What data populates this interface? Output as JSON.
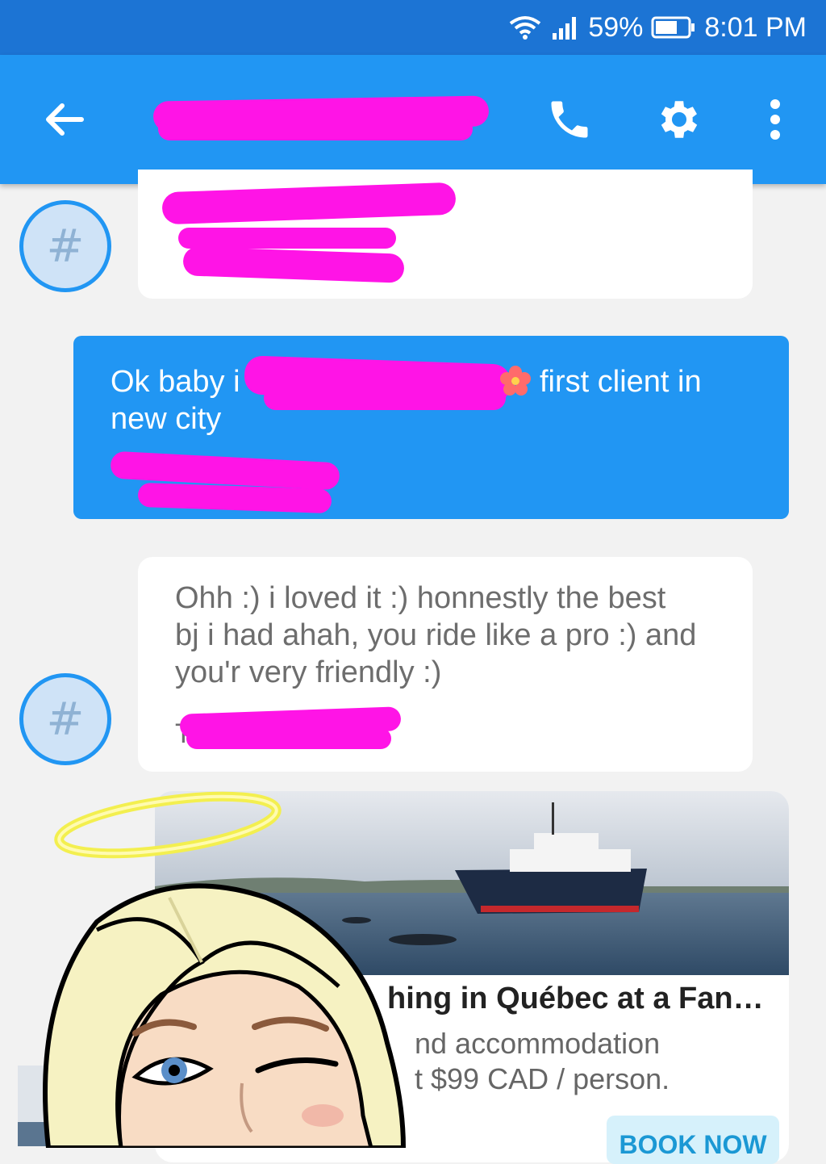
{
  "status_bar": {
    "battery": "59%",
    "time": "8:01 PM"
  },
  "app_bar": {
    "icons": [
      "back-arrow-icon",
      "phone-icon",
      "gear-icon",
      "more-vert-icon"
    ]
  },
  "messages": [
    {
      "direction": "in",
      "avatar_glyph": "#"
    },
    {
      "direction": "out",
      "text_line1_start": "Ok baby i",
      "text_line1_end": "first client in",
      "text_line2": "new city"
    },
    {
      "direction": "in",
      "avatar_glyph": "#",
      "lines": [
        "Ohh :) i loved it :) honnestly the best",
        "bj i had ahah, you ride like a pro :) and",
        "you'r very friendly :)"
      ],
      "time_prefix": "T"
    }
  ],
  "ad": {
    "title": "hing in Québec at a Fan…",
    "line1": "nd accommodation",
    "line2": "t $99 CAD / person.",
    "button": "BOOK NOW"
  },
  "colors": {
    "status_bar": "#1c74d4",
    "app_bar": "#2196f3",
    "redaction": "#ff14e6"
  }
}
